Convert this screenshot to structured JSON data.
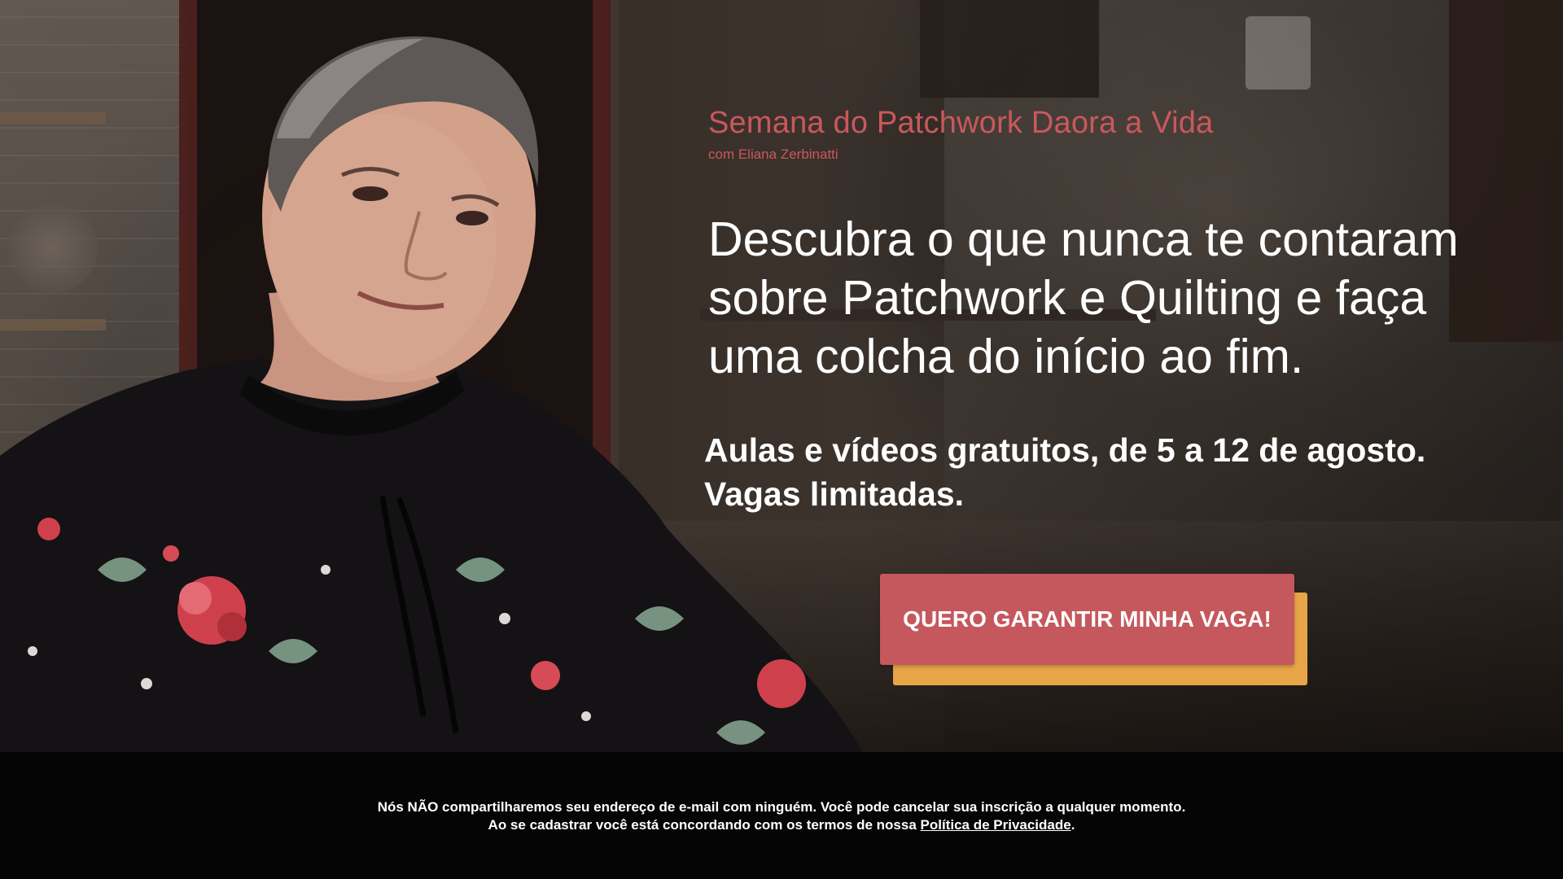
{
  "header": {
    "course_title": "Semana do Patchwork Daora a Vida",
    "course_subtitle": "com Eliana Zerbinatti"
  },
  "main": {
    "headline_lines": [
      "Descubra o que nunca te contaram",
      "sobre Patchwork e Quilting e faça",
      "uma colcha do início ao fim."
    ],
    "subheadline_lines": [
      "Aulas e vídeos gratuitos, de 5 a 12 de agosto.",
      "Vagas limitadas."
    ],
    "cta_label": "QUERO GARANTIR MINHA VAGA!"
  },
  "footer": {
    "line1": "Nós NÃO compartilharemos seu endereço de e-mail com ninguém. Você pode cancelar sua inscrição a qualquer momento.",
    "line2_prefix": "Ao se cadastrar você está concordando com os termos de nossa ",
    "privacy_link": "Política de Privacidade",
    "line2_suffix": "."
  },
  "colors": {
    "accent_red": "#c5585d",
    "accent_orange": "#e7a548",
    "title_red": "#c9585c",
    "footer_bg": "#050505"
  }
}
